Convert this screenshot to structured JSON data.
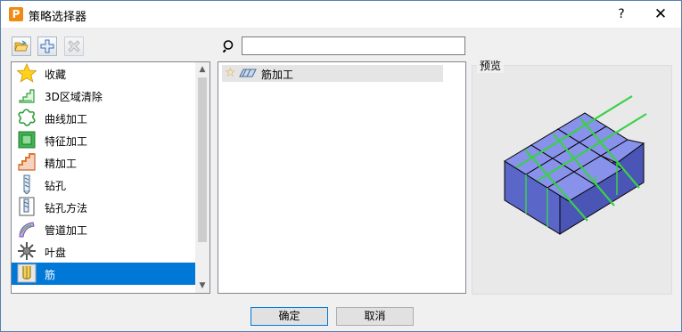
{
  "window": {
    "app_icon_letter": "P",
    "title": "策略选择器",
    "help_glyph": "?",
    "close_glyph": "✕"
  },
  "toolbar": {
    "open_icon": "folder-open-icon",
    "add_icon": "plus-icon",
    "delete_icon": "delete-x-icon"
  },
  "search": {
    "value": "",
    "placeholder": ""
  },
  "categories": [
    {
      "label": "收藏",
      "icon": "star-icon"
    },
    {
      "label": "3D区域清除",
      "icon": "area-clear-icon"
    },
    {
      "label": "曲线加工",
      "icon": "curve-machining-icon"
    },
    {
      "label": "特征加工",
      "icon": "feature-machining-icon"
    },
    {
      "label": "精加工",
      "icon": "finishing-icon"
    },
    {
      "label": "钻孔",
      "icon": "drill-icon"
    },
    {
      "label": "钻孔方法",
      "icon": "drilling-method-icon"
    },
    {
      "label": "管道加工",
      "icon": "pipe-machining-icon"
    },
    {
      "label": "叶盘",
      "icon": "blisk-icon"
    },
    {
      "label": "筋",
      "icon": "rib-icon",
      "selected": true
    }
  ],
  "strategies": [
    {
      "label": "筋加工",
      "icon": "rib-machining-icon",
      "favorite": false
    }
  ],
  "preview": {
    "label": "预览"
  },
  "buttons": {
    "ok": "确定",
    "cancel": "取消"
  },
  "colors": {
    "selection": "#0078d7",
    "block_fill": "#7080e0",
    "rib_line": "#3ad04a"
  }
}
